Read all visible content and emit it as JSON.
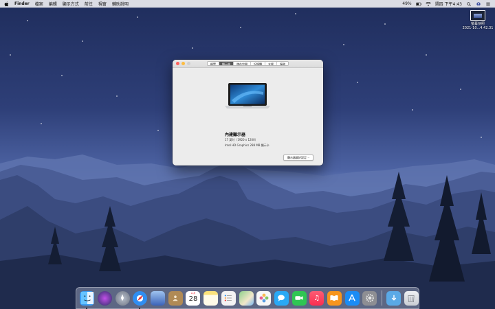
{
  "menubar": {
    "app_name": "Finder",
    "items": [
      "檔案",
      "編輯",
      "顯示方式",
      "前往",
      "視窗",
      "輔助說明"
    ],
    "battery": "49%",
    "clock": "週四 下午4:43",
    "icons": [
      "apple-icon",
      "battery-icon",
      "wifi-icon",
      "search-icon",
      "user-icon",
      "control-center-icon"
    ]
  },
  "desktop_file": {
    "name_line1": "螢幕快照",
    "name_line2": "2021-10...4.42.31"
  },
  "window": {
    "tabs": [
      "概覽",
      "顯示器",
      "儲存空間",
      "記憶體",
      "支援",
      "服務"
    ],
    "active_tab": "顯示器",
    "display_title": "內建顯示器",
    "display_spec": "17 英吋（1920 x 1200）",
    "display_gpu": "Intel HD Graphics 288 MB 顯示卡",
    "prefs_button": "顯示器偏好設定⋯"
  },
  "dock": {
    "calendar_month": "10月",
    "calendar_day": "28",
    "items": [
      {
        "name": "finder",
        "color": "#3b9cf3"
      },
      {
        "name": "siri",
        "color": "#2b2f66"
      },
      {
        "name": "launchpad",
        "color": "#9aa0ad"
      },
      {
        "name": "safari",
        "color": "#2f8ef2"
      },
      {
        "name": "photo-preview",
        "color": "#5b7fd1"
      },
      {
        "name": "contacts",
        "color": "#b08a55"
      },
      {
        "name": "calendar",
        "color": "#ffffff"
      },
      {
        "name": "notes",
        "color": "#fbe27a"
      },
      {
        "name": "reminders",
        "color": "#f3f3f3"
      },
      {
        "name": "maps",
        "color": "#6cbf69"
      },
      {
        "name": "photos",
        "color": "#f7f7f7"
      },
      {
        "name": "messages",
        "color": "#2aa9f5"
      },
      {
        "name": "facetime",
        "color": "#2fc653"
      },
      {
        "name": "music",
        "color": "#f9475d"
      },
      {
        "name": "books",
        "color": "#f7951d"
      },
      {
        "name": "app-store",
        "color": "#1a8cf5"
      },
      {
        "name": "system-preferences",
        "color": "#8e8e93"
      },
      {
        "name": "downloads",
        "color": "#5aa9e6"
      },
      {
        "name": "trash",
        "color": "#d6d9de"
      }
    ]
  }
}
